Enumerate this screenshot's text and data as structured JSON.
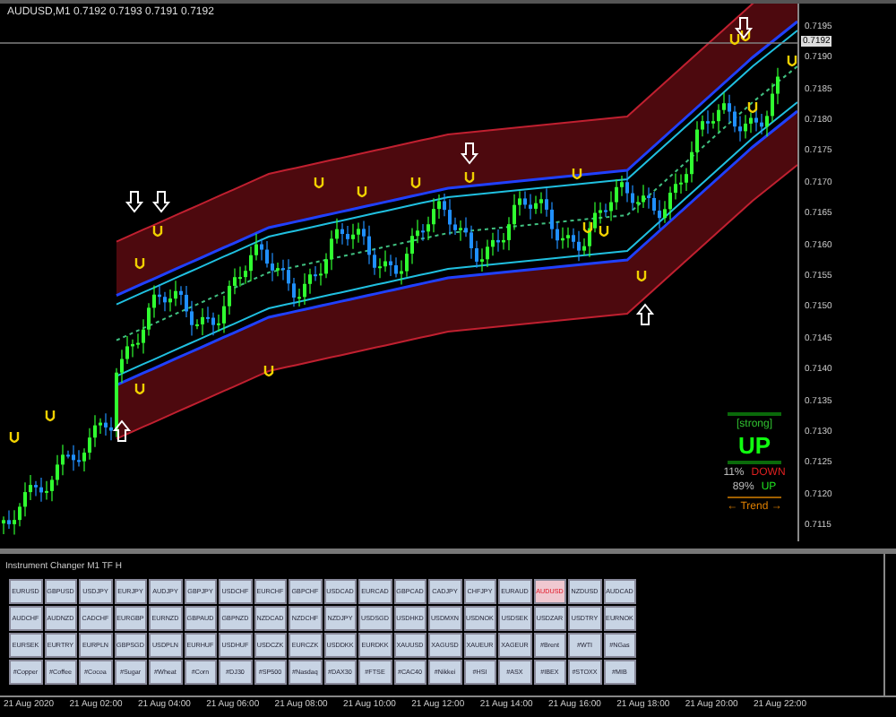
{
  "chart": {
    "header": "AUDUSD,M1 0.7192 0.7193 0.7191 0.7192",
    "current_price": "0.7192"
  },
  "price_axis": [
    "0.7195",
    "0.7190",
    "0.7185",
    "0.7180",
    "0.7175",
    "0.7170",
    "0.7165",
    "0.7160",
    "0.7155",
    "0.7150",
    "0.7145",
    "0.7140",
    "0.7135",
    "0.7130",
    "0.7125",
    "0.7120",
    "0.7115"
  ],
  "trend_panel": {
    "strength": "[strong]",
    "direction": "UP",
    "down_share": "11%",
    "down_label": "DOWN",
    "up_share": "89%",
    "up_label": "UP",
    "trend_label": "← Trend →"
  },
  "instrument_panel": {
    "title": "Instrument Changer M1 TF H",
    "rows": [
      [
        {
          "label": "EURUSD",
          "selected": false
        },
        {
          "label": "GBPUSD",
          "selected": false
        },
        {
          "label": "USDJPY",
          "selected": false
        },
        {
          "label": "EURJPY",
          "selected": false
        },
        {
          "label": "AUDJPY",
          "selected": false
        },
        {
          "label": "GBPJPY",
          "selected": false
        },
        {
          "label": "USDCHF",
          "selected": false
        },
        {
          "label": "EURCHF",
          "selected": false
        },
        {
          "label": "GBPCHF",
          "selected": false
        },
        {
          "label": "USDCAD",
          "selected": false
        },
        {
          "label": "EURCAD",
          "selected": false
        },
        {
          "label": "GBPCAD",
          "selected": false
        },
        {
          "label": "CADJPY",
          "selected": false
        },
        {
          "label": "CHFJPY",
          "selected": false
        },
        {
          "label": "EURAUD",
          "selected": false
        },
        {
          "label": "AUDUSD",
          "selected": true
        },
        {
          "label": "NZDUSD",
          "selected": false
        },
        {
          "label": "AUDCAD",
          "selected": false
        }
      ],
      [
        {
          "label": "AUDCHF",
          "selected": false
        },
        {
          "label": "AUDNZD",
          "selected": false
        },
        {
          "label": "CADCHF",
          "selected": false
        },
        {
          "label": "EURGBP",
          "selected": false
        },
        {
          "label": "EURNZD",
          "selected": false
        },
        {
          "label": "GBPAUD",
          "selected": false
        },
        {
          "label": "GBPNZD",
          "selected": false
        },
        {
          "label": "NZDCAD",
          "selected": false
        },
        {
          "label": "NZDCHF",
          "selected": false
        },
        {
          "label": "NZDJPY",
          "selected": false
        },
        {
          "label": "USDSGD",
          "selected": false
        },
        {
          "label": "USDHKD",
          "selected": false
        },
        {
          "label": "USDMXN",
          "selected": false
        },
        {
          "label": "USDNOK",
          "selected": false
        },
        {
          "label": "USDSEK",
          "selected": false
        },
        {
          "label": "USDZAR",
          "selected": false
        },
        {
          "label": "USDTRY",
          "selected": false
        },
        {
          "label": "EURNOK",
          "selected": false
        }
      ],
      [
        {
          "label": "EURSEK",
          "selected": false
        },
        {
          "label": "EURTRY",
          "selected": false
        },
        {
          "label": "EURPLN",
          "selected": false
        },
        {
          "label": "GBPSGD",
          "selected": false
        },
        {
          "label": "USDPLN",
          "selected": false
        },
        {
          "label": "EURHUF",
          "selected": false
        },
        {
          "label": "USDHUF",
          "selected": false
        },
        {
          "label": "USDCZK",
          "selected": false
        },
        {
          "label": "EURCZK",
          "selected": false
        },
        {
          "label": "USDDKK",
          "selected": false
        },
        {
          "label": "EURDKK",
          "selected": false
        },
        {
          "label": "XAUUSD",
          "selected": false
        },
        {
          "label": "XAGUSD",
          "selected": false
        },
        {
          "label": "XAUEUR",
          "selected": false
        },
        {
          "label": "XAGEUR",
          "selected": false
        },
        {
          "label": "#Brent",
          "selected": false
        },
        {
          "label": "#WTI",
          "selected": false
        },
        {
          "label": "#NGas",
          "selected": false
        }
      ],
      [
        {
          "label": "#Copper",
          "selected": false
        },
        {
          "label": "#Coffee",
          "selected": false
        },
        {
          "label": "#Cocoa",
          "selected": false
        },
        {
          "label": "#Sugar",
          "selected": false
        },
        {
          "label": "#Wheat",
          "selected": false
        },
        {
          "label": "#Corn",
          "selected": false
        },
        {
          "label": "#DJ30",
          "selected": false
        },
        {
          "label": "#SP500",
          "selected": false
        },
        {
          "label": "#Nasdaq",
          "selected": false
        },
        {
          "label": "#DAX30",
          "selected": false
        },
        {
          "label": "#FTSE",
          "selected": false
        },
        {
          "label": "#CAC40",
          "selected": false
        },
        {
          "label": "#Nikkei",
          "selected": false
        },
        {
          "label": "#HSI",
          "selected": false
        },
        {
          "label": "#ASX",
          "selected": false
        },
        {
          "label": "#IBEX",
          "selected": false
        },
        {
          "label": "#STOXX",
          "selected": false
        },
        {
          "label": "#MIB",
          "selected": false
        }
      ]
    ]
  },
  "time_axis": [
    "21 Aug 2020",
    "21 Aug 02:00",
    "21 Aug 04:00",
    "21 Aug 06:00",
    "21 Aug 08:00",
    "21 Aug 10:00",
    "21 Aug 12:00",
    "21 Aug 14:00",
    "21 Aug 16:00",
    "21 Aug 18:00",
    "21 Aug 20:00",
    "21 Aug 22:00"
  ]
}
